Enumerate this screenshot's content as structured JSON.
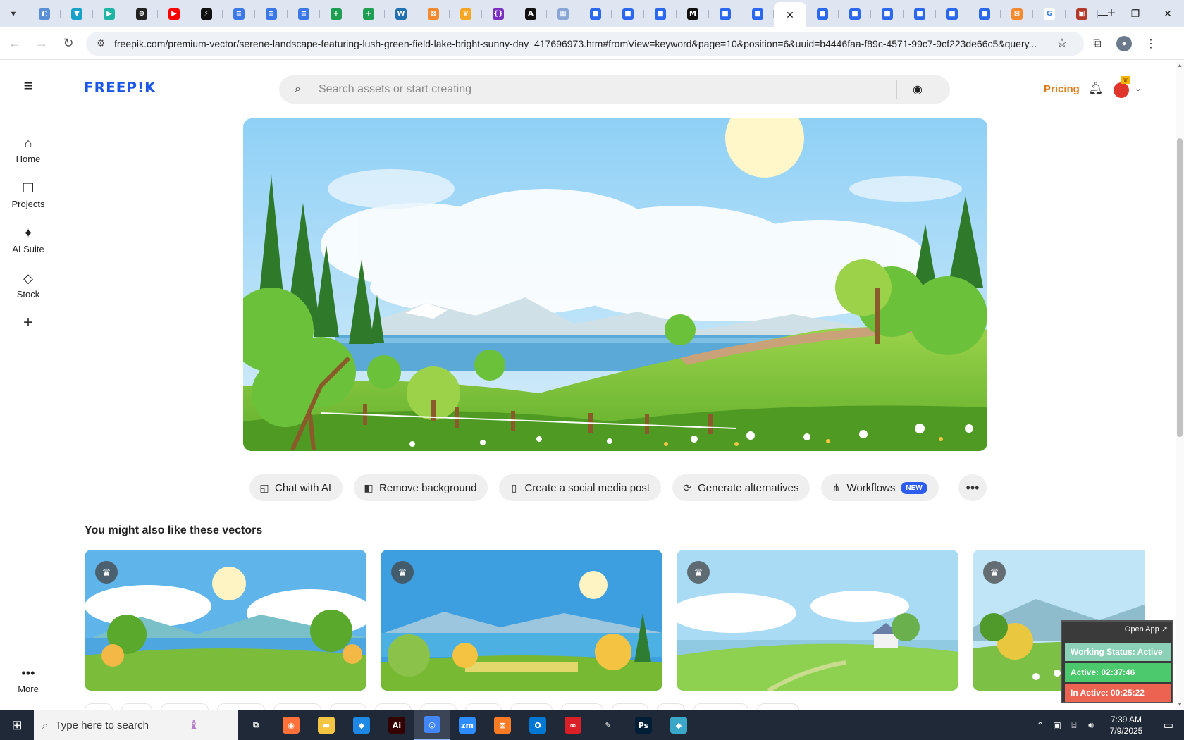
{
  "browser": {
    "tabs": [
      {
        "icon": "globe-icon",
        "color": "#5a8fd8",
        "glyph": "◐"
      },
      {
        "icon": "vpn-icon",
        "color": "#19a2c9",
        "glyph": "▼"
      },
      {
        "icon": "arrow-app-icon",
        "color": "#1fb5a5",
        "glyph": "▶"
      },
      {
        "icon": "openai-icon",
        "color": "#222222",
        "glyph": "⊛"
      },
      {
        "icon": "youtube-icon",
        "color": "#ff0000",
        "glyph": "▶"
      },
      {
        "icon": "bolt-icon",
        "color": "#111111",
        "glyph": "⚡"
      },
      {
        "icon": "docs-icon",
        "color": "#3b78e7",
        "glyph": "≡"
      },
      {
        "icon": "docs-icon",
        "color": "#3b78e7",
        "glyph": "≡"
      },
      {
        "icon": "docs-icon",
        "color": "#3b78e7",
        "glyph": "≡"
      },
      {
        "icon": "sheets-icon",
        "color": "#1e9e52",
        "glyph": "+"
      },
      {
        "icon": "sheets-icon",
        "color": "#1e9e52",
        "glyph": "+"
      },
      {
        "icon": "wp-icon",
        "color": "#2271b1",
        "glyph": "W"
      },
      {
        "icon": "xampp-icon",
        "color": "#f28a30",
        "glyph": "⊠"
      },
      {
        "icon": "crown-icon",
        "color": "#f5a623",
        "glyph": "♛"
      },
      {
        "icon": "code-icon",
        "color": "#7b2fbf",
        "glyph": "{}"
      },
      {
        "icon": "a-icon",
        "color": "#111111",
        "glyph": "A"
      },
      {
        "icon": "grid-icon",
        "color": "#8aa6d6",
        "glyph": "▦"
      },
      {
        "icon": "form-icon",
        "color": "#2a68f0",
        "glyph": "■"
      },
      {
        "icon": "form-icon",
        "color": "#2a68f0",
        "glyph": "■"
      },
      {
        "icon": "form-icon",
        "color": "#2a68f0",
        "glyph": "■"
      },
      {
        "icon": "m-icon",
        "color": "#111111",
        "glyph": "M"
      },
      {
        "icon": "form-icon",
        "color": "#2a68f0",
        "glyph": "■"
      },
      {
        "icon": "form-icon",
        "color": "#2a68f0",
        "glyph": "■"
      },
      {
        "icon": "close-icon",
        "color": "#ffffff",
        "glyph": "✕",
        "active": true
      },
      {
        "icon": "form-icon",
        "color": "#2a68f0",
        "glyph": "■"
      },
      {
        "icon": "form-icon",
        "color": "#2a68f0",
        "glyph": "■"
      },
      {
        "icon": "form-icon",
        "color": "#2a68f0",
        "glyph": "■"
      },
      {
        "icon": "form-icon",
        "color": "#2a68f0",
        "glyph": "■"
      },
      {
        "icon": "form-icon",
        "color": "#2a68f0",
        "glyph": "■"
      },
      {
        "icon": "form-icon",
        "color": "#2a68f0",
        "glyph": "■"
      },
      {
        "icon": "xampp-icon",
        "color": "#f28a30",
        "glyph": "⊠"
      },
      {
        "icon": "google-icon",
        "color": "#ffffff",
        "glyph": "G"
      },
      {
        "icon": "game-icon",
        "color": "#b33a2a",
        "glyph": "▣"
      }
    ],
    "url": "freepik.com/premium-vector/serene-landscape-featuring-lush-green-field-lake-bright-sunny-day_417696973.htm#fromView=keyword&page=10&position=6&uuid=b4446faa-f89c-4571-99c7-9cf223de66c5&query..."
  },
  "header": {
    "logo": "FREEP!K",
    "search_placeholder": "Search assets or start creating",
    "pricing": "Pricing"
  },
  "sidebar": {
    "items": [
      {
        "label": "Home",
        "icon": "home-icon"
      },
      {
        "label": "Projects",
        "icon": "projects-icon"
      },
      {
        "label": "AI Suite",
        "icon": "sparkle-icon"
      },
      {
        "label": "Stock",
        "icon": "shapes-icon"
      }
    ],
    "more": "More"
  },
  "actions": [
    {
      "label": "Chat with AI",
      "icon": "chat-ai-icon"
    },
    {
      "label": "Remove background",
      "icon": "remove-bg-icon"
    },
    {
      "label": "Create a social media post",
      "icon": "phone-icon"
    },
    {
      "label": "Generate alternatives",
      "icon": "refresh-icon"
    },
    {
      "label": "Workflows",
      "icon": "workflow-icon",
      "badge": "NEW"
    }
  ],
  "section_title": "You might also like these vectors",
  "status_widget": {
    "open_app": "Open App ↗",
    "working": "Working Status: Active",
    "active": "Active: 02:37:46",
    "inactive": "In Active: 00:25:22"
  },
  "taskbar": {
    "search_placeholder": "Type here to search",
    "apps": [
      {
        "icon": "task-view-icon",
        "color": "#1f2937",
        "glyph": "⧉"
      },
      {
        "icon": "firefox-icon",
        "color": "#ff7139",
        "glyph": "◉"
      },
      {
        "icon": "file-explorer-icon",
        "color": "#f4c542",
        "glyph": "▬"
      },
      {
        "icon": "vscode-icon",
        "color": "#1e88e5",
        "glyph": "◆"
      },
      {
        "icon": "illustrator-icon",
        "color": "#330000",
        "glyph": "Ai"
      },
      {
        "icon": "chrome-icon",
        "color": "#4285f4",
        "glyph": "◎",
        "active": true
      },
      {
        "icon": "zoom-icon",
        "color": "#2d8cff",
        "glyph": "zm"
      },
      {
        "icon": "xampp-icon",
        "color": "#fb7a24",
        "glyph": "⊠"
      },
      {
        "icon": "outlook-icon",
        "color": "#0078d4",
        "glyph": "O"
      },
      {
        "icon": "creative-cloud-icon",
        "color": "#da1f26",
        "glyph": "∞"
      },
      {
        "icon": "pen-tool-icon",
        "color": "#1f2937",
        "glyph": "✎"
      },
      {
        "icon": "photoshop-icon",
        "color": "#001e36",
        "glyph": "Ps"
      },
      {
        "icon": "app-icon",
        "color": "#3aa7c9",
        "glyph": "◆"
      }
    ],
    "time": "7:39 AM",
    "date": "7/9/2025"
  }
}
